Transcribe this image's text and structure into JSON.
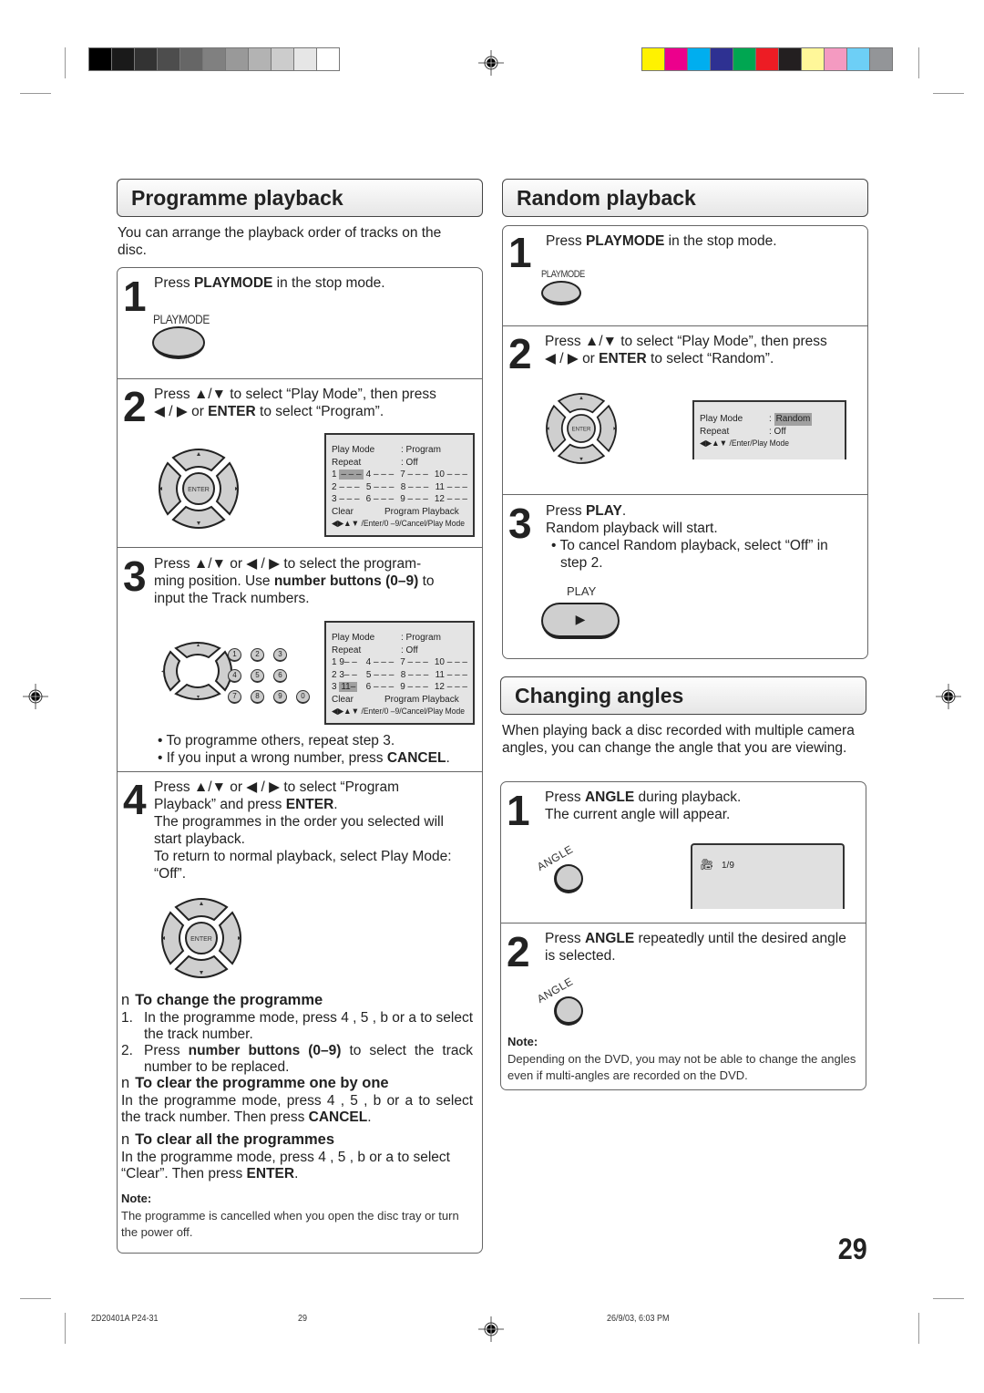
{
  "print_marks": {
    "gray_swatches": [
      "#000000",
      "#1a1a1a",
      "#333333",
      "#4d4d4d",
      "#666666",
      "#808080",
      "#999999",
      "#b3b3b3",
      "#cccccc",
      "#e6e6e6",
      "#ffffff"
    ],
    "color_swatches": [
      "#fff200",
      "#ec008c",
      "#00aeef",
      "#2e3192",
      "#00a651",
      "#ed1c24",
      "#231f20",
      "#fff799",
      "#f49ac1",
      "#6dcff6",
      "#939598"
    ]
  },
  "programme": {
    "title": "Programme playback",
    "intro": "You can arrange the playback order of tracks on the disc.",
    "step1": {
      "num": "1",
      "pre": "Press ",
      "bold": "PLAYMODE",
      "post": " in the stop mode.",
      "button_label": "PLAYMODE"
    },
    "step2": {
      "num": "2",
      "line1_pre": "Press ",
      "arrows_ud": "▲/▼",
      "line1_post": " to select “Play Mode”, then press",
      "arrows_lr": "◀ / ▶",
      "line2_mid": " or ",
      "line2_bold": "ENTER",
      "line2_post": " to select “Program”.",
      "enter_label": "ENTER",
      "osd": {
        "play_mode_label": "Play Mode",
        "play_mode_value": ": Program",
        "repeat_label": "Repeat",
        "repeat_value": ": Off",
        "slots": [
          [
            "1",
            "– – –",
            "4 – – –",
            "7 – – –",
            "10 – – –"
          ],
          [
            "2 – – –",
            "5 – – –",
            "8 – – –",
            "11 – – –"
          ],
          [
            "3 – – –",
            "6 – – –",
            "9 – – –",
            "12 – – –"
          ]
        ],
        "clear": "Clear",
        "program_playback": "Program Playback",
        "nav": "◀▶▲▼ /Enter/0 –9/Cancel/Play Mode"
      }
    },
    "step3": {
      "num": "3",
      "line1": "Press ▲/▼ or ◀ / ▶ to select the program-",
      "line2_pre": "ming position. Use ",
      "line2_bold": "number buttons (0–9)",
      "line2_post": " to",
      "line3": "input the Track numbers.",
      "numbers": [
        "1",
        "2",
        "3",
        "4",
        "5",
        "6",
        "7",
        "8",
        "9",
        "0"
      ],
      "osd": {
        "play_mode_label": "Play Mode",
        "play_mode_value": ": Program",
        "repeat_label": "Repeat",
        "repeat_value": ": Off",
        "slots": [
          [
            "1 9– –",
            "4 – – –",
            "7 – – –",
            "10 – – –"
          ],
          [
            "2 3– –",
            "5 – – –",
            "8 – – –",
            "11 – – –"
          ],
          [
            "3",
            "11–",
            "6 – – –",
            "9 – – –",
            "12 – – –"
          ]
        ],
        "clear": "Clear",
        "program_playback": "Program Playback",
        "nav": "◀▶▲▼ /Enter/0 –9/Cancel/Play Mode"
      },
      "bullet1": "To programme others, repeat step 3.",
      "bullet2_pre": "If you input a wrong number, press ",
      "bullet2_bold": "CANCEL",
      "bullet2_post": "."
    },
    "step4": {
      "num": "4",
      "line1": "Press ▲/▼ or ◀ / ▶ to select “Program",
      "line2_pre": "Playback” and press ",
      "line2_bold": "ENTER",
      "line2_post": ".",
      "line3": "The programmes in the order you selected will start playback.",
      "line4": "To return to normal playback, select Play Mode: “Off”.",
      "enter_label": "ENTER"
    },
    "change": {
      "marker": "n",
      "title": "To change the programme",
      "item1": "In the programme mode, press 4 , 5 , b  or a  to select the track number.",
      "item2_pre": "Press ",
      "item2_bold": "number buttons (0–9)",
      "item2_post": " to select the track number to be replaced."
    },
    "clear_one": {
      "marker": "n",
      "title": "To clear the programme one by one",
      "text_pre": "In the programme mode, press 4 , 5 , b  or a  to select the track number. Then press ",
      "text_bold": "CANCEL",
      "text_post": "."
    },
    "clear_all": {
      "marker": "n",
      "title": "To clear all the programmes",
      "text_pre": "In the programme mode, press 4 , 5 , b  or a  to select “Clear”. Then press ",
      "text_bold": "ENTER",
      "text_post": "."
    },
    "note_heading": "Note:",
    "note": "The programme is cancelled when you open the disc tray or turn the power off."
  },
  "random": {
    "title": "Random playback",
    "step1": {
      "num": "1",
      "pre": "Press ",
      "bold": "PLAYMODE",
      "post": " in the stop mode.",
      "button_label": "PLAYMODE"
    },
    "step2": {
      "num": "2",
      "line1": "Press ▲/▼ to select “Play Mode”, then press",
      "line2_pre": "◀ / ▶ or ",
      "line2_bold": "ENTER",
      "line2_post": " to select “Random”.",
      "enter_label": "ENTER",
      "osd": {
        "play_mode_label": "Play Mode",
        "play_mode_colon": ":",
        "play_mode_value": "Random",
        "repeat_label": "Repeat",
        "repeat_value": ": Off",
        "nav": "◀▶▲▼ /Enter/Play Mode"
      }
    },
    "step3": {
      "num": "3",
      "pre": "Press ",
      "bold": "PLAY",
      "post": ".",
      "line2": "Random playback will start.",
      "bullet": "To cancel Random playback, select “Off” in step 2.",
      "button_label": "PLAY",
      "button_icon": "▶"
    }
  },
  "angles": {
    "title": "Changing angles",
    "intro": "When playing back a disc recorded with multiple camera angles, you can change the angle that you are viewing.",
    "step1": {
      "num": "1",
      "pre": "Press ",
      "bold": "ANGLE",
      "post": " during playback.",
      "line2": "The current angle will appear.",
      "button_label": "ANGLE",
      "display_value": "1/9"
    },
    "step2": {
      "num": "2",
      "pre": "Press ",
      "bold": "ANGLE",
      "post": " repeatedly until the desired angle is selected.",
      "button_label": "ANGLE"
    },
    "note_heading": "Note:",
    "note": "Depending on the DVD, you may not be able to change the angles even if multi-angles are recorded on the DVD."
  },
  "page_number": "29",
  "footer": {
    "code": "2D20401A P24-31",
    "page": "29",
    "date": "26/9/03, 6:03 PM"
  }
}
